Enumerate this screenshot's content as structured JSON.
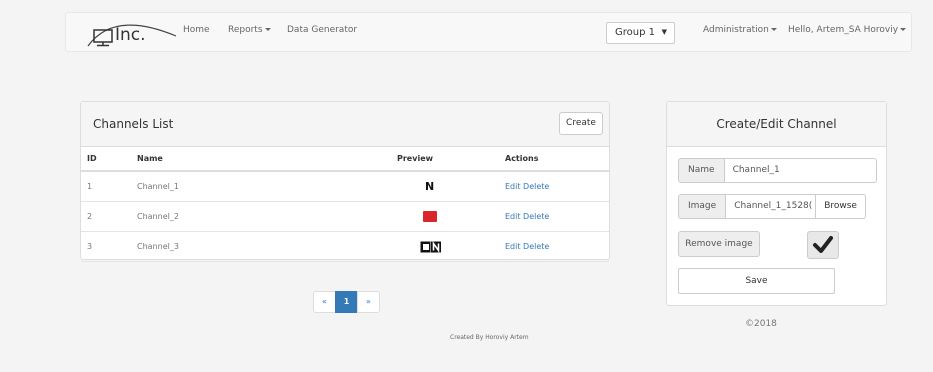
{
  "navbar": {
    "logo_text": "Inc.",
    "links": {
      "home": "Home",
      "reports": "Reports",
      "data_generator": "Data Generator",
      "administration": "Administration",
      "user": "Hello, Artem_SA Horoviy"
    },
    "group_select": {
      "value": "Group 1"
    }
  },
  "channels_list": {
    "title": "Channels List",
    "create_label": "Create",
    "columns": {
      "id": "ID",
      "name": "Name",
      "preview": "Preview",
      "actions": "Actions"
    },
    "rows": [
      {
        "id": "1",
        "name": "Channel_1",
        "preview": "netflix-logo-icon",
        "edit": "Edit",
        "delete": "Delete"
      },
      {
        "id": "2",
        "name": "Channel_2",
        "preview": "red-channel-logo-icon",
        "edit": "Edit",
        "delete": "Delete"
      },
      {
        "id": "3",
        "name": "Channel_3",
        "preview": "cartoon-network-logo-icon",
        "edit": "Edit",
        "delete": "Delete"
      }
    ]
  },
  "pagination": {
    "prev": "«",
    "current": "1",
    "next": "»"
  },
  "footer": {
    "created_by": "Created By Horoviy Artem",
    "copyright": "©2018"
  },
  "edit_panel": {
    "title": "Create/Edit Channel",
    "name_label": "Name",
    "name_value": "Channel_1",
    "image_label": "Image",
    "image_value": "Channel_1_1528(",
    "browse_label": "Browse",
    "remove_image_label": "Remove image",
    "save_label": "Save",
    "checkbox_checked": true
  },
  "colors": {
    "link": "#337ab7",
    "active_page": "#337ab7"
  }
}
